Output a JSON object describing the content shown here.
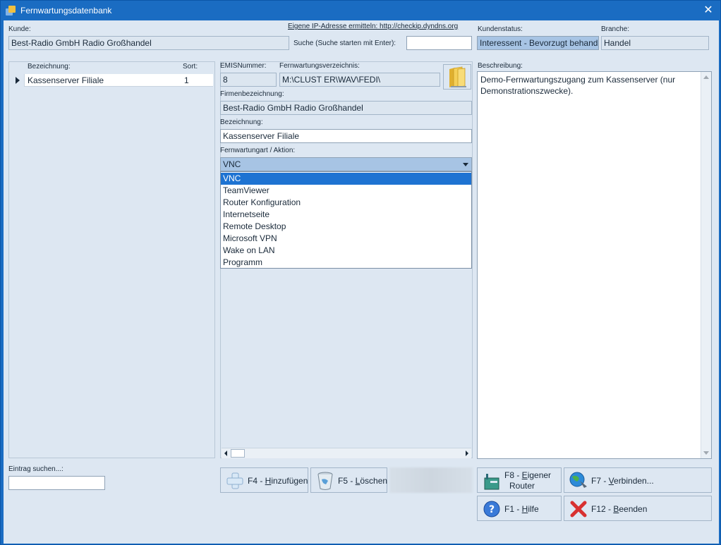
{
  "window": {
    "title": "Fernwartungsdatenbank"
  },
  "labels": {
    "kunde": "Kunde:",
    "ip_link": "Eigene IP-Adresse ermitteln: http://checkip.dyndns.org",
    "suche": "Suche (Suche starten mit Enter):",
    "kundenstatus": "Kundenstatus:",
    "branche": "Branche:",
    "emis": "EMISNummer:",
    "fernwartungsverzeichnis": "Fernwartungsverzeichnis:",
    "firmenbezeichnung": "Firmenbezeichnung:",
    "bezeichnung": "Bezeichnung:",
    "fernwartungsart": "Fernwartungart / Aktion:",
    "beschreibung": "Beschreibung:",
    "eintrag_suchen": "Eintrag suchen...:"
  },
  "fields": {
    "kunde": "Best-Radio GmbH Radio Großhandel",
    "suche": "",
    "kundenstatus": "Interessent - Bevorzugt behandeln",
    "branche": "Handel",
    "emis": "8",
    "fernwartungsverzeichnis": "M:\\CLUST ER\\WAV\\FEDI\\",
    "firmenbezeichnung": "Best-Radio GmbH Radio Großhandel",
    "bezeichnung": "Kassenserver Filiale",
    "fernwartungsart": "VNC",
    "beschreibung": "Demo-Fernwartungszugang zum Kassenserver (nur Demonstrationszwecke).",
    "eintrag_suchen": ""
  },
  "grid": {
    "columns": [
      "Bezeichnung:",
      "Sort:"
    ],
    "rows": [
      {
        "bezeichnung": "Kassenserver Filiale",
        "sort": "1"
      }
    ]
  },
  "dropdown": {
    "options": [
      "VNC",
      "TeamViewer",
      "Router Konfiguration",
      "Internetseite",
      "Remote Desktop",
      "Microsoft VPN",
      "Wake on LAN",
      "Programm"
    ],
    "selected": "VNC"
  },
  "buttons": {
    "hinzufuegen": {
      "pre": "F4 - ",
      "key": "H",
      "post": "inzufügen"
    },
    "loeschen": {
      "pre": "F5 - ",
      "key": "L",
      "post": "öschen"
    },
    "router_line1": {
      "pre": "F8 - ",
      "key": "E",
      "post": "igener"
    },
    "router_line2": "Router",
    "verbinden": {
      "pre": "F7 - ",
      "key": "V",
      "post": "erbinden..."
    },
    "hilfe": {
      "pre": "F1 - ",
      "key": "H",
      "post": "ilfe"
    },
    "beenden": {
      "pre": "F12 - ",
      "key": "B",
      "post": "eenden"
    }
  },
  "icons": {
    "app": "app-icon",
    "close": "close-icon",
    "folder": "folder-icon",
    "add": "add-icon",
    "delete": "trash-icon",
    "router": "router-icon",
    "connect": "globe-connect-icon",
    "help": "help-icon",
    "exit": "red-x-icon"
  }
}
